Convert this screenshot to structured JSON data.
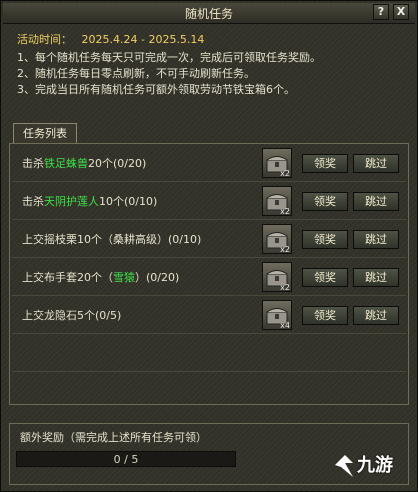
{
  "window": {
    "title": "随机任务",
    "help_label": "?",
    "close_label": "X"
  },
  "header": {
    "time_label": "活动时间：",
    "time_range": "2025.4.24 - 2025.5.14",
    "rules": [
      "1、每个随机任务每天只可完成一次，完成后可领取任务奖励。",
      "2、随机任务每日零点刷新，不可手动刷新任务。",
      "3、完成当日所有随机任务可额外领取劳动节铁宝箱6个。"
    ]
  },
  "tabs": [
    {
      "label": "任务列表",
      "active": true
    }
  ],
  "tasks": [
    {
      "prefix": "击杀",
      "highlight": "铁足蛛兽",
      "suffix": "20个(0/20)",
      "reward_qty": "x2",
      "claim_label": "领奖",
      "skip_label": "跳过"
    },
    {
      "prefix": "击杀",
      "highlight": "天阴护莲人",
      "suffix": "10个(0/10)",
      "reward_qty": "x2",
      "claim_label": "领奖",
      "skip_label": "跳过"
    },
    {
      "prefix": "上交摇枝栗10个（桑耕高级）(0/10)",
      "highlight": "",
      "suffix": "",
      "reward_qty": "x2",
      "claim_label": "领奖",
      "skip_label": "跳过"
    },
    {
      "prefix": "上交布手套20个（",
      "highlight": "雪猿",
      "suffix": "）(0/20)",
      "reward_qty": "x2",
      "claim_label": "领奖",
      "skip_label": "跳过"
    },
    {
      "prefix": "上交龙隐石5个(0/5)",
      "highlight": "",
      "suffix": "",
      "reward_qty": "x4",
      "claim_label": "领奖",
      "skip_label": "跳过"
    }
  ],
  "bonus": {
    "label": "额外奖励（需完成上述所有任务可领）",
    "progress_text": "0 / 5",
    "progress": 0
  },
  "watermark": {
    "text": "九游"
  },
  "colors": {
    "highlight": "#3ee04a",
    "time": "#f0d060"
  }
}
